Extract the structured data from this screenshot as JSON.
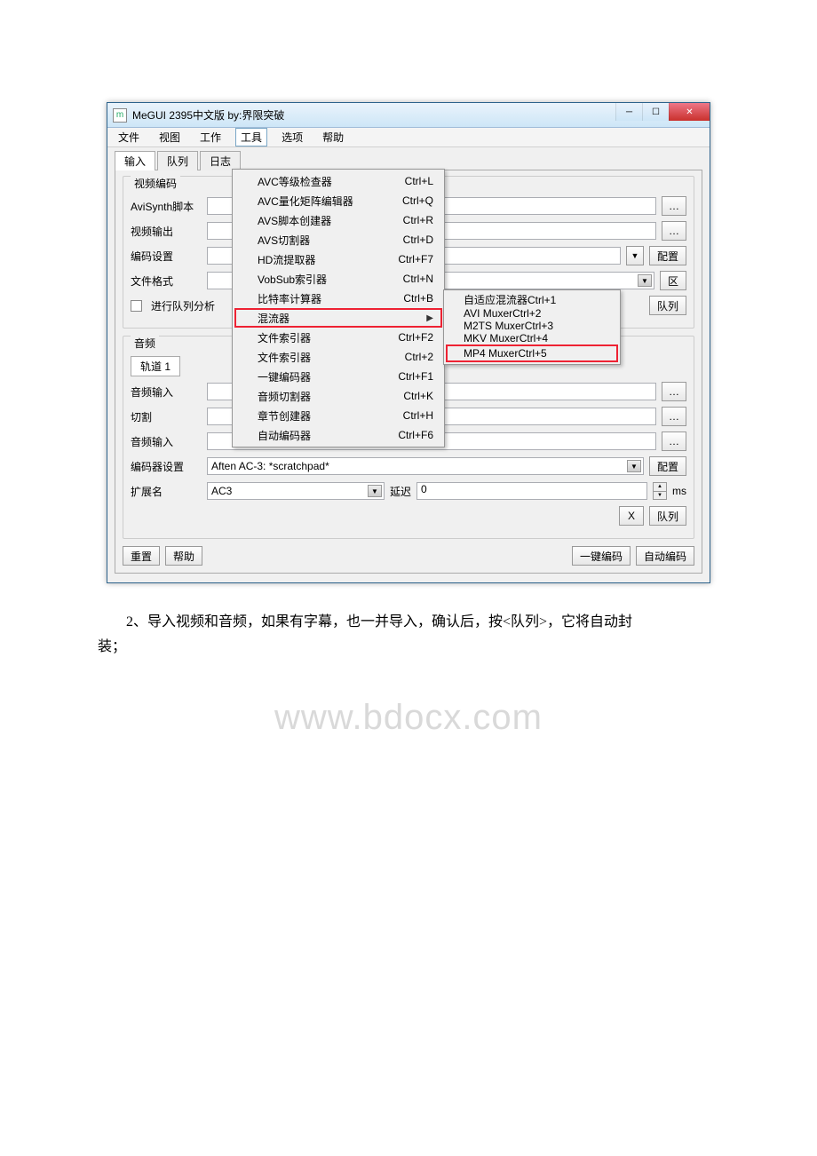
{
  "window": {
    "title": "MeGUI 2395中文版 by:界限突破",
    "icon_text": "m"
  },
  "menubar": [
    "文件",
    "视图",
    "工作",
    "工具",
    "选项",
    "帮助"
  ],
  "tabs": [
    "输入",
    "队列",
    "日志"
  ],
  "video_group": {
    "title": "视频编码",
    "avisynth_label": "AviSynth脚本",
    "output_label": "视频输出",
    "encode_settings_label": "编码设置",
    "file_format_label": "文件格式",
    "queue_analysis_label": "进行队列分析",
    "config_btn": "配置",
    "area_btn": "区",
    "queue_btn": "队列"
  },
  "audio_group": {
    "title": "音频",
    "track_label": "轨道 1",
    "input_label": "音频输入",
    "cut_label": "切割",
    "input2_label": "音频输入",
    "encoder_settings_label": "编码器设置",
    "encoder_value": "Aften AC-3: *scratchpad*",
    "ext_label": "扩展名",
    "ext_value": "AC3",
    "delay_label": "延迟",
    "delay_value": "0",
    "ms_label": "ms",
    "config_btn": "配置",
    "x_btn": "X",
    "queue_btn": "队列"
  },
  "footer": {
    "reset": "重置",
    "help": "帮助",
    "one_click": "一键编码",
    "auto_encode": "自动编码"
  },
  "tools_menu": [
    {
      "label": "AVC等级检查器",
      "shortcut": "Ctrl+L"
    },
    {
      "label": "AVC量化矩阵编辑器",
      "shortcut": "Ctrl+Q"
    },
    {
      "label": "AVS脚本创建器",
      "shortcut": "Ctrl+R"
    },
    {
      "label": "AVS切割器",
      "shortcut": "Ctrl+D"
    },
    {
      "label": "HD流提取器",
      "shortcut": "Ctrl+F7"
    },
    {
      "label": "VobSub索引器",
      "shortcut": "Ctrl+N"
    },
    {
      "label": "比特率计算器",
      "shortcut": "Ctrl+B"
    },
    {
      "label": "混流器",
      "shortcut": "",
      "submenu": true,
      "highlight": true
    },
    {
      "label": "文件索引器",
      "shortcut": "Ctrl+F2"
    },
    {
      "label": "文件索引器",
      "shortcut": "Ctrl+2"
    },
    {
      "label": "一键编码器",
      "shortcut": "Ctrl+F1"
    },
    {
      "label": "音频切割器",
      "shortcut": "Ctrl+K"
    },
    {
      "label": "章节创建器",
      "shortcut": "Ctrl+H"
    },
    {
      "label": "自动编码器",
      "shortcut": "Ctrl+F6"
    }
  ],
  "muxer_submenu": [
    {
      "label": "自适应混流器",
      "shortcut": "Ctrl+1"
    },
    {
      "label": "AVI Muxer",
      "shortcut": "Ctrl+2"
    },
    {
      "label": "M2TS Muxer",
      "shortcut": "Ctrl+3"
    },
    {
      "label": "MKV Muxer",
      "shortcut": "Ctrl+4"
    },
    {
      "label": "MP4 Muxer",
      "shortcut": "Ctrl+5",
      "highlight": true
    }
  ],
  "watermark": "www.bdocx.com",
  "body_text": {
    "line1": "2、导入视频和音频，如果有字幕，也一并导入，确认后，按<队列>，它将自动封",
    "line2": "装；"
  }
}
